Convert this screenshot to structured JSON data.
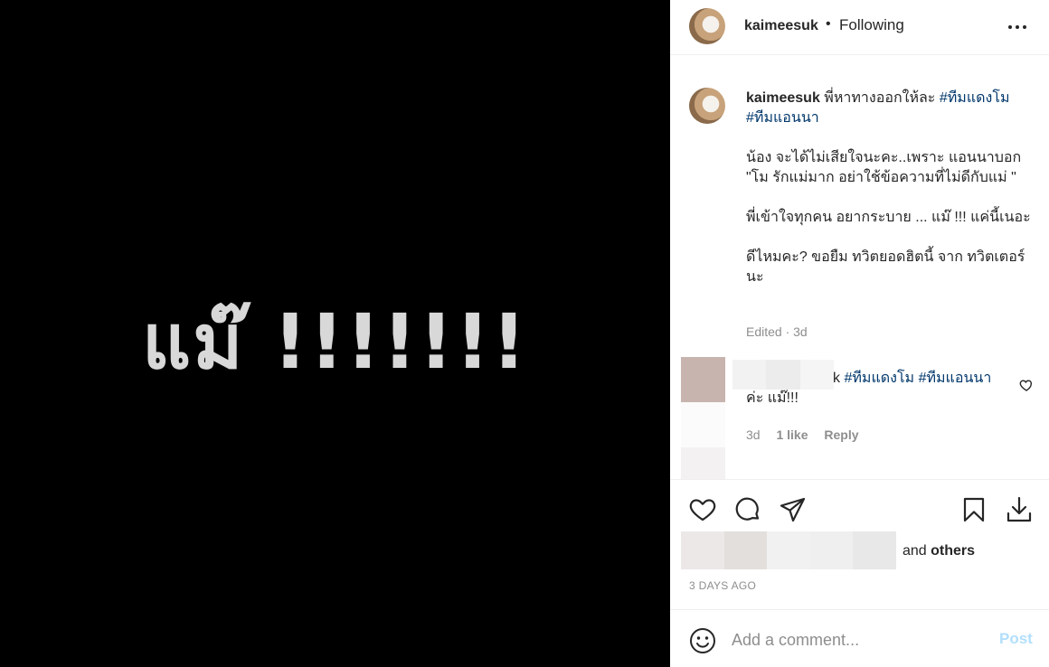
{
  "post": {
    "image_text": "แม๊ !!!!!!!",
    "username": "kaimeesuk",
    "follow_status": "Following",
    "caption": {
      "username": "kaimeesuk",
      "line1": "พี่หาทางออกให้ละ",
      "tag1": "#ทีมแดงโม",
      "tag2": "#ทีมแอนนา",
      "para1": "น้อง จะได้ไม่เสียใจนะคะ..เพราะ แอนนาบอก \"โม รักแม่มาก อย่าใช้ข้อความที่ไม่ดีกับแม่ \"",
      "para2": "พี่เข้าใจทุกคน อยากระบาย ... แม๊ !!! แค่นี้เนอะ",
      "para3": "ดีไหมคะ? ขอยืม ทวิตยอดฮิตนี้ จาก ทวิตเตอร์ นะ",
      "meta": "Edited · 3d"
    },
    "comments": [
      {
        "prefix": "k",
        "tag1": "#ทีมแดงโม",
        "tag2": "#ทีมแอนนา",
        "text": "ค่ะ แม๊!!!",
        "time": "3d",
        "likes": "1 like",
        "reply": "Reply"
      }
    ],
    "likes_text": "and",
    "likes_others": "others",
    "timestamp": "3 DAYS AGO",
    "comment_placeholder": "Add a comment...",
    "post_label": "Post"
  },
  "colors": {
    "hashtag": "#00376b",
    "muted": "#8e8e8e",
    "post_button": "#b2dffc"
  },
  "icons": [
    "more-icon",
    "heart-icon",
    "comment-icon",
    "share-icon",
    "bookmark-icon",
    "download-icon",
    "emoji-icon"
  ]
}
